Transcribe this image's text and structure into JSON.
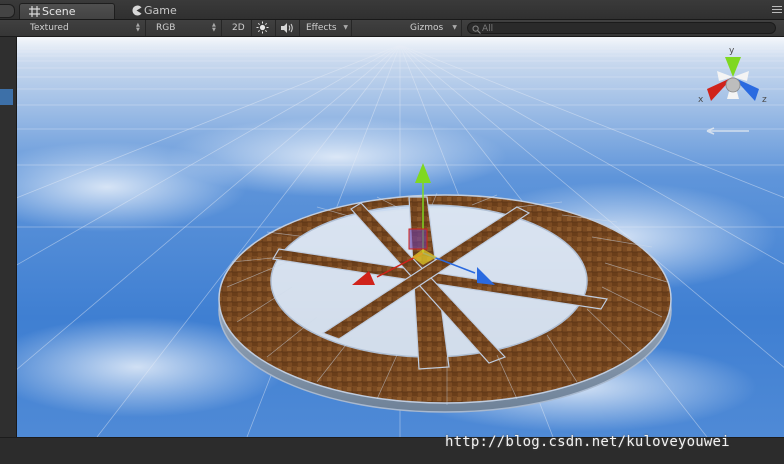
{
  "tabs": [
    {
      "label": "Scene",
      "active": true,
      "icon": "grid-icon"
    },
    {
      "label": "Game",
      "active": false,
      "icon": "pacman-icon"
    }
  ],
  "toolbar": {
    "render_mode": "Textured",
    "color_mode": "RGB",
    "mode_2d": "2D",
    "lighting_icon": "sun-icon",
    "audio_icon": "speaker-icon",
    "effects": "Effects",
    "gizmos": "Gizmos",
    "search_placeholder": "All"
  },
  "gizmo": {
    "y_label": "y",
    "x_label": "x",
    "z_label": "z"
  },
  "watermark": "http://blog.csdn.net/kuloveyouwei",
  "colors": {
    "selection_blue": "#3d70a8",
    "axis_x": "#d0231b",
    "axis_y": "#7fd821",
    "axis_z": "#2a6ae0",
    "wood": "#7a4a22"
  }
}
